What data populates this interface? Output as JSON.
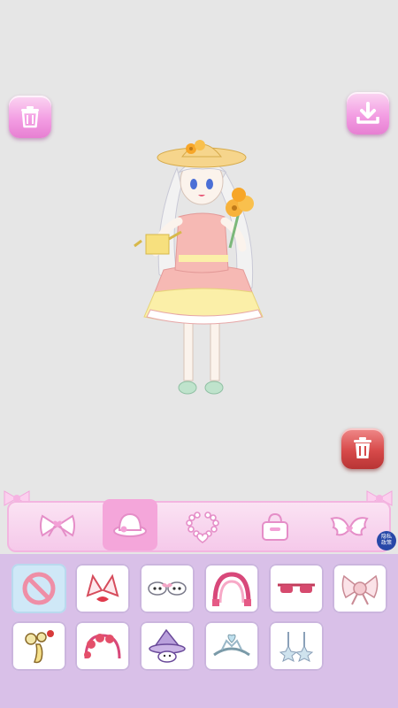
{
  "toolbar": {
    "tabs": [
      {
        "name": "bow"
      },
      {
        "name": "hat"
      },
      {
        "name": "necklace"
      },
      {
        "name": "bag"
      },
      {
        "name": "wings"
      }
    ],
    "active_tab": "hat",
    "privacy_label": "隐私政策"
  },
  "items_grid": {
    "selected_index": 0,
    "items": [
      {
        "icon": "none-icon"
      },
      {
        "icon": "cat-ears-icon"
      },
      {
        "icon": "bunny-headband-icon"
      },
      {
        "icon": "floral-arch-icon"
      },
      {
        "icon": "sunglasses-icon"
      },
      {
        "icon": "flower-bow-icon"
      },
      {
        "icon": "cherry-clip-icon"
      },
      {
        "icon": "rose-headband-icon"
      },
      {
        "icon": "witch-hat-cat-icon"
      },
      {
        "icon": "tiara-icon"
      },
      {
        "icon": "star-earrings-icon"
      }
    ]
  },
  "colors": {
    "accent_pink": "#f39ee3",
    "delete_red": "#d74a4a",
    "panel_purple": "#d9c0e8"
  }
}
